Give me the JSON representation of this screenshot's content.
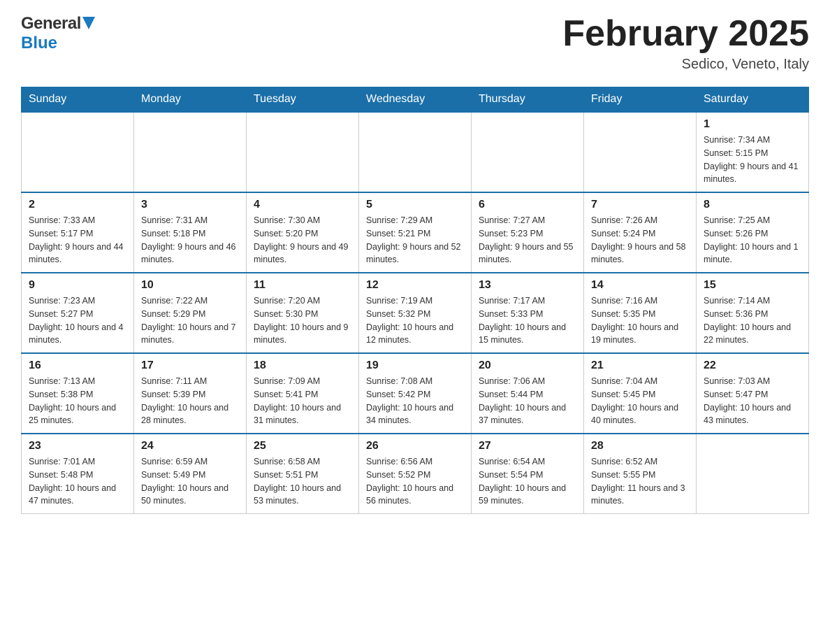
{
  "header": {
    "logo_general": "General",
    "logo_blue": "Blue",
    "month_title": "February 2025",
    "location": "Sedico, Veneto, Italy"
  },
  "days_of_week": [
    "Sunday",
    "Monday",
    "Tuesday",
    "Wednesday",
    "Thursday",
    "Friday",
    "Saturday"
  ],
  "weeks": [
    [
      {
        "day": "",
        "info": ""
      },
      {
        "day": "",
        "info": ""
      },
      {
        "day": "",
        "info": ""
      },
      {
        "day": "",
        "info": ""
      },
      {
        "day": "",
        "info": ""
      },
      {
        "day": "",
        "info": ""
      },
      {
        "day": "1",
        "info": "Sunrise: 7:34 AM\nSunset: 5:15 PM\nDaylight: 9 hours and 41 minutes."
      }
    ],
    [
      {
        "day": "2",
        "info": "Sunrise: 7:33 AM\nSunset: 5:17 PM\nDaylight: 9 hours and 44 minutes."
      },
      {
        "day": "3",
        "info": "Sunrise: 7:31 AM\nSunset: 5:18 PM\nDaylight: 9 hours and 46 minutes."
      },
      {
        "day": "4",
        "info": "Sunrise: 7:30 AM\nSunset: 5:20 PM\nDaylight: 9 hours and 49 minutes."
      },
      {
        "day": "5",
        "info": "Sunrise: 7:29 AM\nSunset: 5:21 PM\nDaylight: 9 hours and 52 minutes."
      },
      {
        "day": "6",
        "info": "Sunrise: 7:27 AM\nSunset: 5:23 PM\nDaylight: 9 hours and 55 minutes."
      },
      {
        "day": "7",
        "info": "Sunrise: 7:26 AM\nSunset: 5:24 PM\nDaylight: 9 hours and 58 minutes."
      },
      {
        "day": "8",
        "info": "Sunrise: 7:25 AM\nSunset: 5:26 PM\nDaylight: 10 hours and 1 minute."
      }
    ],
    [
      {
        "day": "9",
        "info": "Sunrise: 7:23 AM\nSunset: 5:27 PM\nDaylight: 10 hours and 4 minutes."
      },
      {
        "day": "10",
        "info": "Sunrise: 7:22 AM\nSunset: 5:29 PM\nDaylight: 10 hours and 7 minutes."
      },
      {
        "day": "11",
        "info": "Sunrise: 7:20 AM\nSunset: 5:30 PM\nDaylight: 10 hours and 9 minutes."
      },
      {
        "day": "12",
        "info": "Sunrise: 7:19 AM\nSunset: 5:32 PM\nDaylight: 10 hours and 12 minutes."
      },
      {
        "day": "13",
        "info": "Sunrise: 7:17 AM\nSunset: 5:33 PM\nDaylight: 10 hours and 15 minutes."
      },
      {
        "day": "14",
        "info": "Sunrise: 7:16 AM\nSunset: 5:35 PM\nDaylight: 10 hours and 19 minutes."
      },
      {
        "day": "15",
        "info": "Sunrise: 7:14 AM\nSunset: 5:36 PM\nDaylight: 10 hours and 22 minutes."
      }
    ],
    [
      {
        "day": "16",
        "info": "Sunrise: 7:13 AM\nSunset: 5:38 PM\nDaylight: 10 hours and 25 minutes."
      },
      {
        "day": "17",
        "info": "Sunrise: 7:11 AM\nSunset: 5:39 PM\nDaylight: 10 hours and 28 minutes."
      },
      {
        "day": "18",
        "info": "Sunrise: 7:09 AM\nSunset: 5:41 PM\nDaylight: 10 hours and 31 minutes."
      },
      {
        "day": "19",
        "info": "Sunrise: 7:08 AM\nSunset: 5:42 PM\nDaylight: 10 hours and 34 minutes."
      },
      {
        "day": "20",
        "info": "Sunrise: 7:06 AM\nSunset: 5:44 PM\nDaylight: 10 hours and 37 minutes."
      },
      {
        "day": "21",
        "info": "Sunrise: 7:04 AM\nSunset: 5:45 PM\nDaylight: 10 hours and 40 minutes."
      },
      {
        "day": "22",
        "info": "Sunrise: 7:03 AM\nSunset: 5:47 PM\nDaylight: 10 hours and 43 minutes."
      }
    ],
    [
      {
        "day": "23",
        "info": "Sunrise: 7:01 AM\nSunset: 5:48 PM\nDaylight: 10 hours and 47 minutes."
      },
      {
        "day": "24",
        "info": "Sunrise: 6:59 AM\nSunset: 5:49 PM\nDaylight: 10 hours and 50 minutes."
      },
      {
        "day": "25",
        "info": "Sunrise: 6:58 AM\nSunset: 5:51 PM\nDaylight: 10 hours and 53 minutes."
      },
      {
        "day": "26",
        "info": "Sunrise: 6:56 AM\nSunset: 5:52 PM\nDaylight: 10 hours and 56 minutes."
      },
      {
        "day": "27",
        "info": "Sunrise: 6:54 AM\nSunset: 5:54 PM\nDaylight: 10 hours and 59 minutes."
      },
      {
        "day": "28",
        "info": "Sunrise: 6:52 AM\nSunset: 5:55 PM\nDaylight: 11 hours and 3 minutes."
      },
      {
        "day": "",
        "info": ""
      }
    ]
  ]
}
